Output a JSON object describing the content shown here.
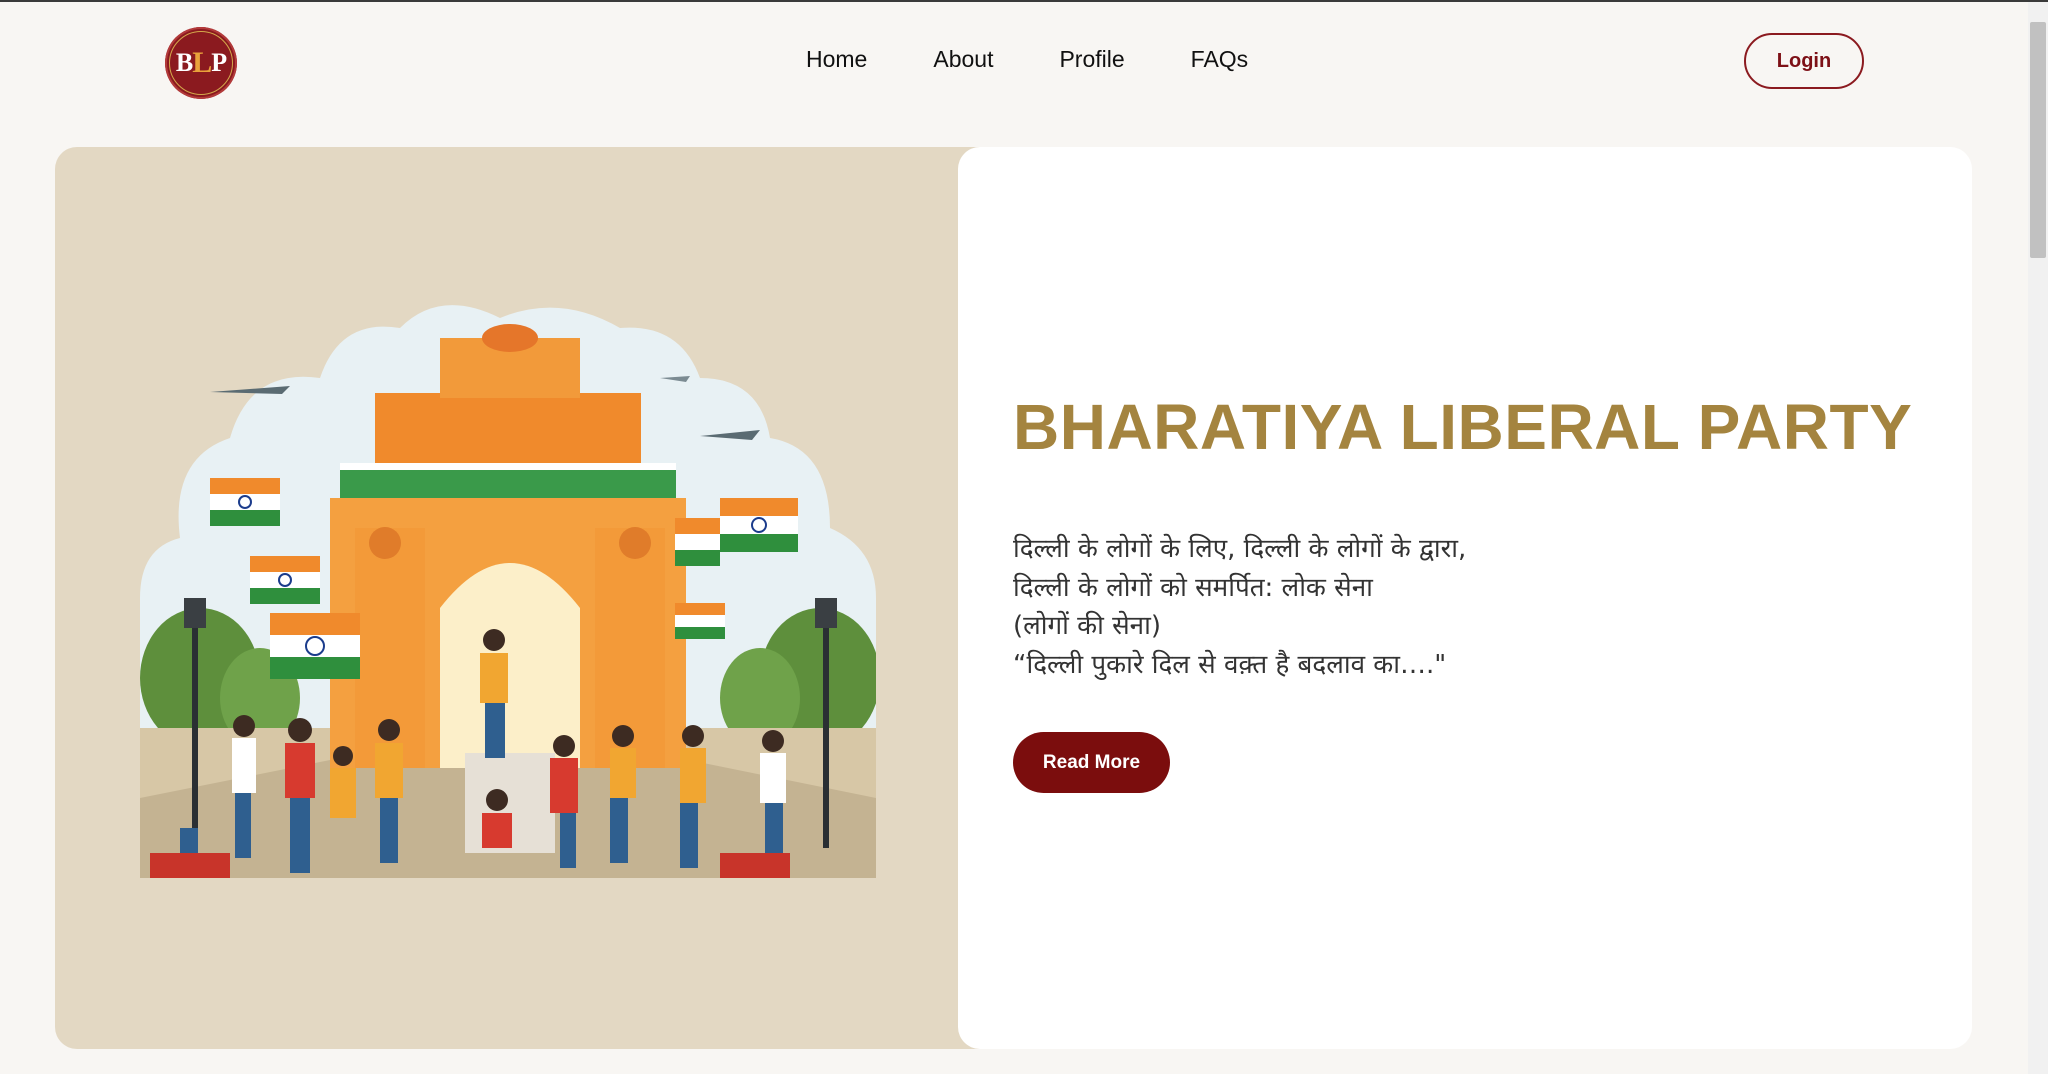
{
  "header": {
    "logo_text": "BLP",
    "nav": [
      {
        "label": "Home"
      },
      {
        "label": "About"
      },
      {
        "label": "Profile"
      },
      {
        "label": "FAQs"
      }
    ],
    "login_label": "Login"
  },
  "hero": {
    "title": "BHARATIYA LIBERAL PARTY",
    "tagline": [
      "दिल्ली के लोगों के लिए, दिल्ली के लोगों के द्वारा,",
      "दिल्ली के लोगों को समर्पित: लोक सेना",
      "(लोगों की सेना)",
      "“दिल्ली पुकारे दिल से वक़्त है बदलाव का….\""
    ],
    "read_more_label": "Read More"
  },
  "colors": {
    "accent": "#7b0d0d",
    "title_gold": "#a4843f",
    "hero_left_bg": "#e3d8c3",
    "page_bg": "#f8f6f3"
  },
  "illustration": {
    "semantic": "india-gate-crowd-with-flags-illustration"
  }
}
